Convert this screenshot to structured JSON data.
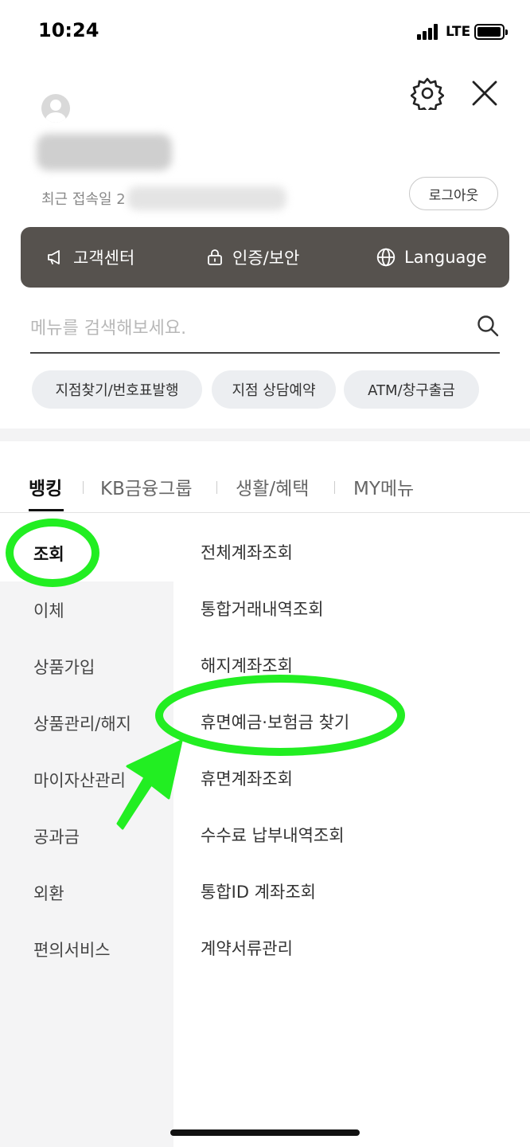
{
  "status_bar": {
    "time": "10:24",
    "network": "LTE",
    "battery_level": 0.85
  },
  "header": {
    "settings_icon": "gear-icon",
    "close_icon": "close-icon"
  },
  "profile": {
    "last_login_label": "최근 접속일 2",
    "logout_label": "로그아웃"
  },
  "quick_menu": [
    {
      "label": "고객센터",
      "icon": "megaphone-icon"
    },
    {
      "label": "인증/보안",
      "icon": "lock-icon"
    },
    {
      "label": "Language",
      "icon": "globe-icon"
    }
  ],
  "search": {
    "placeholder": "메뉴를 검색해보세요.",
    "value": ""
  },
  "chips": [
    "지점찾기/번호표발행",
    "지점 상담예약",
    "ATM/창구출금"
  ],
  "tabs": [
    "뱅킹",
    "KB금융그룹",
    "생활/혜택",
    "MY메뉴"
  ],
  "active_tab": "뱅킹",
  "left_menu": [
    "조회",
    "이체",
    "상품가입",
    "상품관리/해지",
    "마이자산관리",
    "공과금",
    "외환",
    "편의서비스"
  ],
  "active_left": "조회",
  "sub_menu": [
    "전체계좌조회",
    "통합거래내역조회",
    "해지계좌조회",
    "휴면예금·보험금 찾기",
    "휴면계좌조회",
    "수수료 납부내역조회",
    "통합ID 계좌조회",
    "계약서류관리"
  ],
  "colors": {
    "quick_bar": "#56524e",
    "annotation": "#22ee22",
    "left_menu_bg": "#f4f4f5",
    "chip_bg": "#eceef1"
  }
}
